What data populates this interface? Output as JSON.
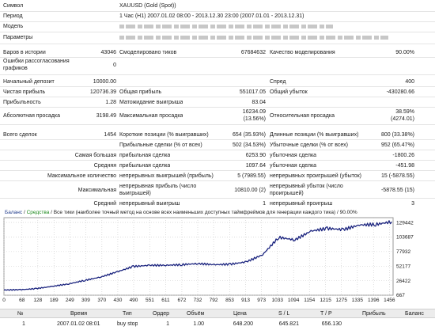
{
  "report": {
    "symbol": {
      "label": "Символ",
      "value": "XAUUSD (Gold (Spot))"
    },
    "period": {
      "label": "Период",
      "value": "1 Час (H1) 2007.01.02 08:00 - 2013.12.30 23:00 (2007.01.01 - 2013.12.31)"
    },
    "model": {
      "label": "Модель"
    },
    "parameters": {
      "label": "Параметры"
    },
    "bars": {
      "label": "Баров в истории",
      "value": "43046"
    },
    "ticks": {
      "label": "Смоделировано тиков",
      "value": "67684632"
    },
    "quality": {
      "label": "Качество моделирования",
      "value": "90.00%"
    },
    "errors": {
      "label": "Ошибки рассогласования графиков",
      "value": "0"
    },
    "deposit": {
      "label": "Начальный депозит",
      "value": "10000.00"
    },
    "spread": {
      "label": "Спред",
      "value": "400"
    },
    "net_profit": {
      "label": "Чистая прибыль",
      "value": "120736.39"
    },
    "gross_profit": {
      "label": "Общая прибыль",
      "value": "551017.05"
    },
    "gross_loss": {
      "label": "Общий убыток",
      "value": "-430280.66"
    },
    "profit_factor": {
      "label": "Прибыльность",
      "value": "1.28"
    },
    "expected_payoff": {
      "label": "Матожидание выигрыша",
      "value": "83.04"
    },
    "abs_drawdown": {
      "label": "Абсолютная просадка",
      "value": "3198.49"
    },
    "max_drawdown": {
      "label": "Максимальная просадка",
      "value": "16234.09",
      "value2": "(13.56%)"
    },
    "rel_drawdown": {
      "label": "Относительная просадка",
      "value": "38.59%",
      "value2": "(4274.01)"
    },
    "total_trades": {
      "label": "Всего сделок",
      "value": "1454"
    },
    "short_pos": {
      "label": "Короткие позиции (% выигравших)",
      "value": "654 (35.93%)"
    },
    "long_pos": {
      "label": "Длинные позиции (% выигравших)",
      "value": "800 (33.38%)"
    },
    "profit_trades": {
      "label": "Прибыльные сделки (% от всех)",
      "value": "502 (34.53%)"
    },
    "loss_trades": {
      "label": "Убыточные сделки (% от всех)",
      "value": "952 (65.47%)"
    },
    "largest": {
      "label": "Самая большая",
      "profit_label": "прибыльная сделка",
      "profit_value": "6253.90",
      "loss_label": "убыточная сделка",
      "loss_value": "-1800.26"
    },
    "average": {
      "label": "Средняя",
      "profit_label": "прибыльная сделка",
      "profit_value": "1097.64",
      "loss_label": "убыточная сделка",
      "loss_value": "-451.98"
    },
    "max_count": {
      "label": "Максимальное количество",
      "profit_label": "непрерывных выигрышей (прибыль)",
      "profit_value": "5 (7989.55)",
      "loss_label": "непрерывных проигрышей (убыток)",
      "loss_value": "15 (-5878.55)"
    },
    "maximal": {
      "label": "Максимальная",
      "profit_label": "непрерывная прибыль (число выигрышей)",
      "profit_value": "10810.00 (2)",
      "loss_label": "непрерывный убыток (число проигрышей)",
      "loss_value": "-5878.55 (15)"
    },
    "avg_cons": {
      "label": "Средний",
      "profit_label": "непрерывный выигрыш",
      "profit_value": "1",
      "loss_label": "непрерывный проигрыш",
      "loss_value": "3"
    }
  },
  "chart_title": {
    "balance": "Баланс",
    "sep1": " / ",
    "equity": "Средства",
    "rest": " / Все тики (наиболее точный метод на основе всех наименьших доступных таймфреймов для генерации каждого тика) / 90.00%"
  },
  "colors": {
    "balance_line": "#1a237e",
    "grid": "#c8c8c8"
  },
  "chart_data": {
    "type": "line",
    "series": [
      {
        "x": [
          0,
          61,
          122,
          183,
          245,
          306,
          367,
          428,
          489,
          550,
          611,
          672,
          733,
          794,
          855,
          916,
          977,
          1038,
          1099,
          1160,
          1221,
          1282,
          1343,
          1404,
          1465
        ],
        "values": [
          10000,
          10400,
          12300,
          16400,
          20700,
          27000,
          33000,
          42100,
          51600,
          53600,
          53700,
          54700,
          56700,
          54700,
          55600,
          59700,
          72300,
          103100,
          98600,
          114200,
          118900,
          116800,
          125100,
          125900,
          130700
        ]
      }
    ],
    "xlim": [
      0,
      1470
    ],
    "ylim": [
      667,
      138000
    ],
    "x_ticks": [
      0,
      68,
      128,
      189,
      249,
      309,
      370,
      430,
      490,
      551,
      611,
      672,
      732,
      792,
      853,
      913,
      973,
      1033,
      1094,
      1154,
      1215,
      1275,
      1335,
      1396,
      1456
    ],
    "y_ticks": [
      667,
      26422,
      52177,
      77932,
      103687,
      129442
    ],
    "grid": true
  },
  "deals": {
    "headers": [
      "№",
      "Время",
      "Тип",
      "Ордер",
      "Объём",
      "Цена",
      "S / L",
      "T / P",
      "Прибыль",
      "Баланс"
    ],
    "rows": [
      [
        "1",
        "2007.01.02 08:01",
        "buy stop",
        "1",
        "1.00",
        "648.200",
        "645.821",
        "656.130",
        "",
        ""
      ]
    ]
  }
}
